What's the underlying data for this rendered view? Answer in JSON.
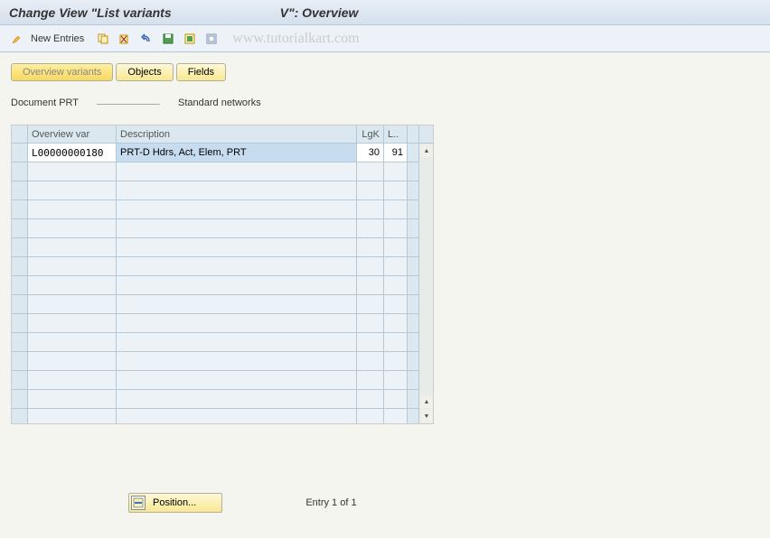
{
  "header": {
    "title_part1": "Change View \"List variants",
    "title_part2": "V\": Overview"
  },
  "toolbar": {
    "new_entries": "New Entries"
  },
  "watermark": "www.tutorialkart.com",
  "tabs": {
    "overview_variants": "Overview variants",
    "objects": "Objects",
    "fields": "Fields"
  },
  "info": {
    "label1": "Document PRT",
    "value1": "",
    "label2": "Standard networks"
  },
  "table": {
    "headers": {
      "ovvar": "Overview var",
      "desc": "Description",
      "lgk": "LgK",
      "l": "L.."
    },
    "rows": [
      {
        "ovvar": "L00000000180",
        "desc": "PRT-D Hdrs, Act, Elem, PRT",
        "lgk": "30",
        "l": "91"
      }
    ]
  },
  "footer": {
    "position": "Position...",
    "entry": "Entry 1 of 1"
  }
}
